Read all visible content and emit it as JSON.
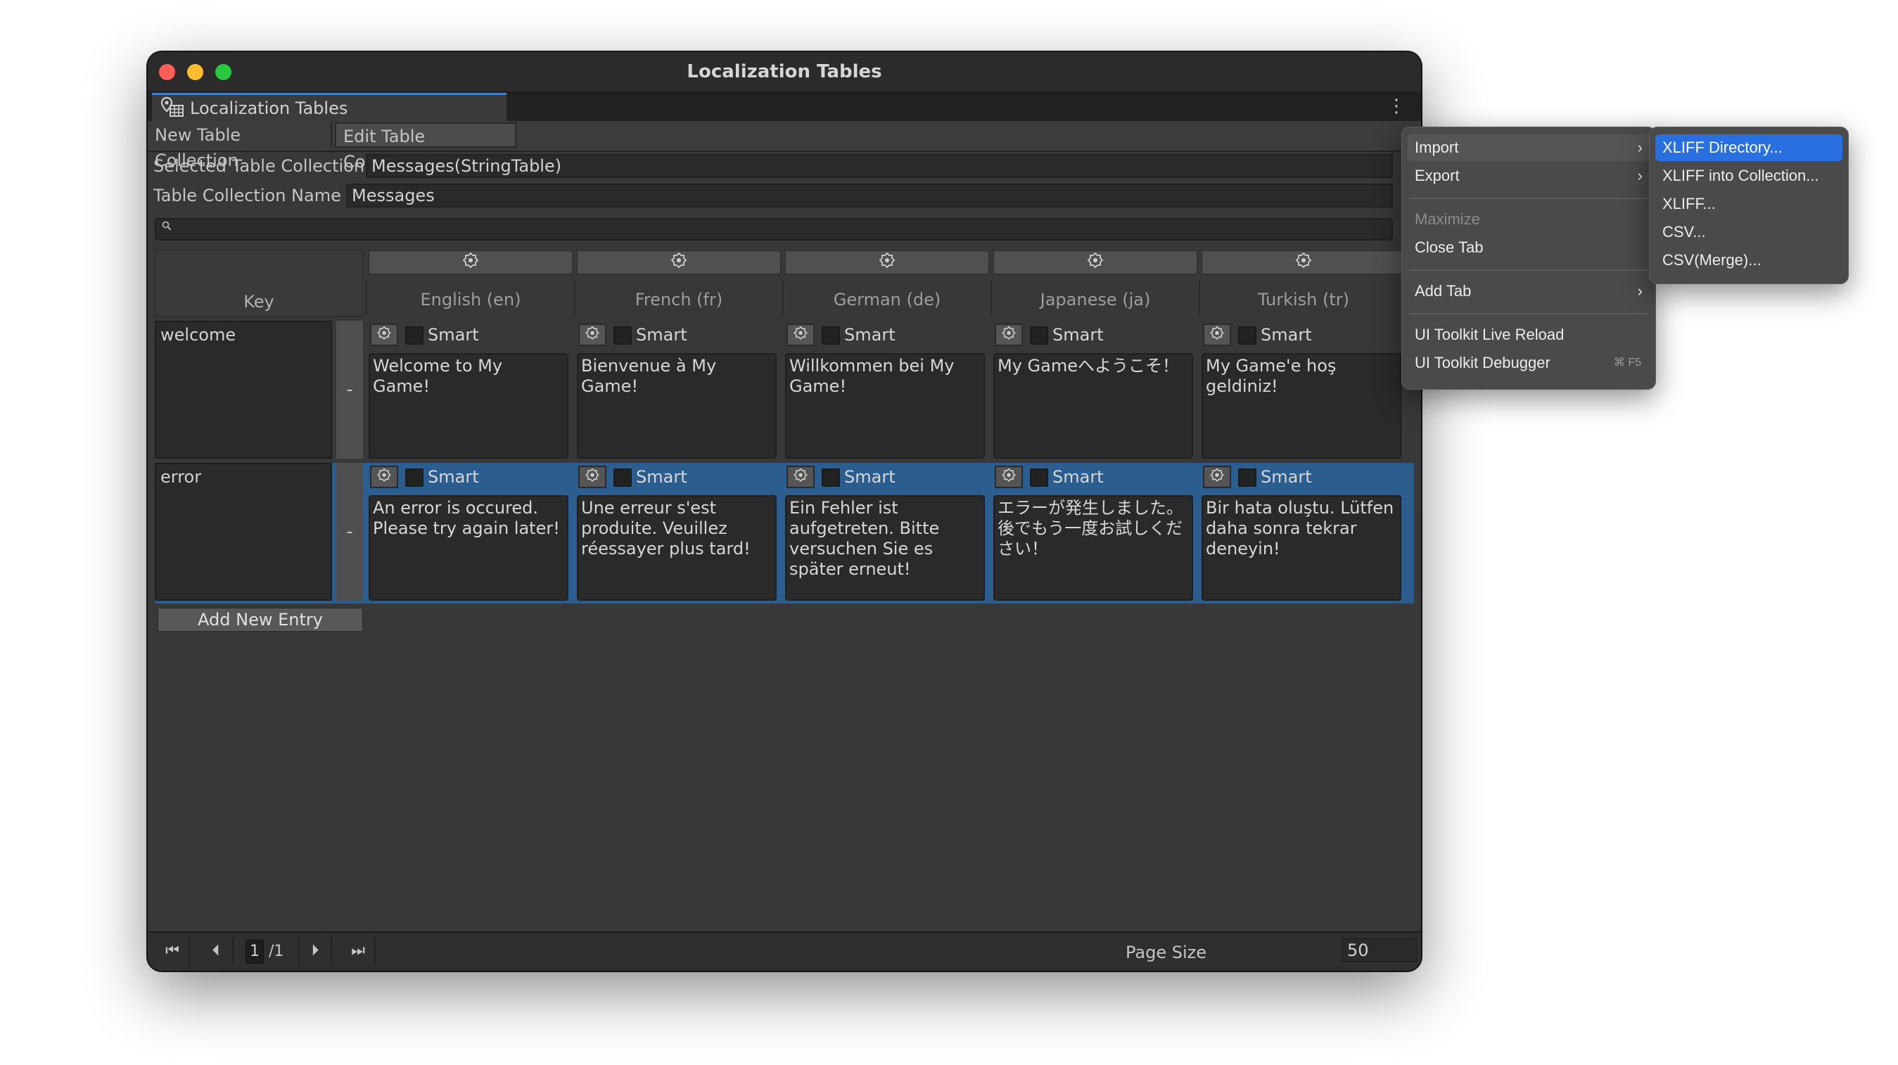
{
  "window": {
    "title": "Localization Tables"
  },
  "tab": {
    "label": "Localization Tables",
    "icon": "localization-table-icon"
  },
  "toolbar": {
    "new_label": "New Table Collection",
    "edit_label": "Edit Table Collection"
  },
  "selected_collection": {
    "label": "Selected Table Collection",
    "value": "Messages(StringTable)"
  },
  "collection_name": {
    "label": "Table Collection Name",
    "value": "Messages"
  },
  "search": {
    "placeholder": ""
  },
  "table": {
    "key_header": "Key",
    "languages": [
      "English (en)",
      "French (fr)",
      "German (de)",
      "Japanese (ja)",
      "Turkish (tr)"
    ],
    "smart_label": "Smart",
    "remove_label": "-",
    "entries": [
      {
        "key": "welcome",
        "values": [
          "Welcome to My Game!",
          "Bienvenue à My Game!",
          "Willkommen bei My Game!",
          "My Gameへようこそ！",
          "My Game'e hoş geldiniz!"
        ]
      },
      {
        "key": "error",
        "values": [
          "An error is occured. Please try again later!",
          "Une erreur s'est produite. Veuillez réessayer plus tard!",
          "Ein Fehler ist aufgetreten. Bitte versuchen Sie es später erneut!",
          "エラーが発生しました。後でもう一度お試しください！",
          "Bir hata oluştu. Lütfen daha sonra tekrar deneyin!"
        ]
      }
    ],
    "add_entry_label": "Add New Entry"
  },
  "pager": {
    "current_page": "1",
    "total": "/1",
    "page_size_label": "Page Size",
    "page_size": "50"
  },
  "context_menu": {
    "items": [
      {
        "label": "Import",
        "has_submenu": true
      },
      {
        "label": "Export",
        "has_submenu": true
      },
      {
        "label": "Maximize",
        "disabled": true
      },
      {
        "label": "Close Tab"
      },
      {
        "label": "Add Tab",
        "has_submenu": true
      },
      {
        "label": "UI Toolkit Live Reload"
      },
      {
        "label": "UI Toolkit Debugger",
        "shortcut": "⌘ F5"
      }
    ]
  },
  "import_submenu": {
    "items": [
      "XLIFF Directory...",
      "XLIFF into Collection...",
      "XLIFF...",
      "CSV...",
      "CSV(Merge)..."
    ]
  },
  "colors": {
    "selection": "#2a6fe0",
    "selected_row": "#2c5d8f",
    "tab_accent": "#3d7fcf"
  }
}
